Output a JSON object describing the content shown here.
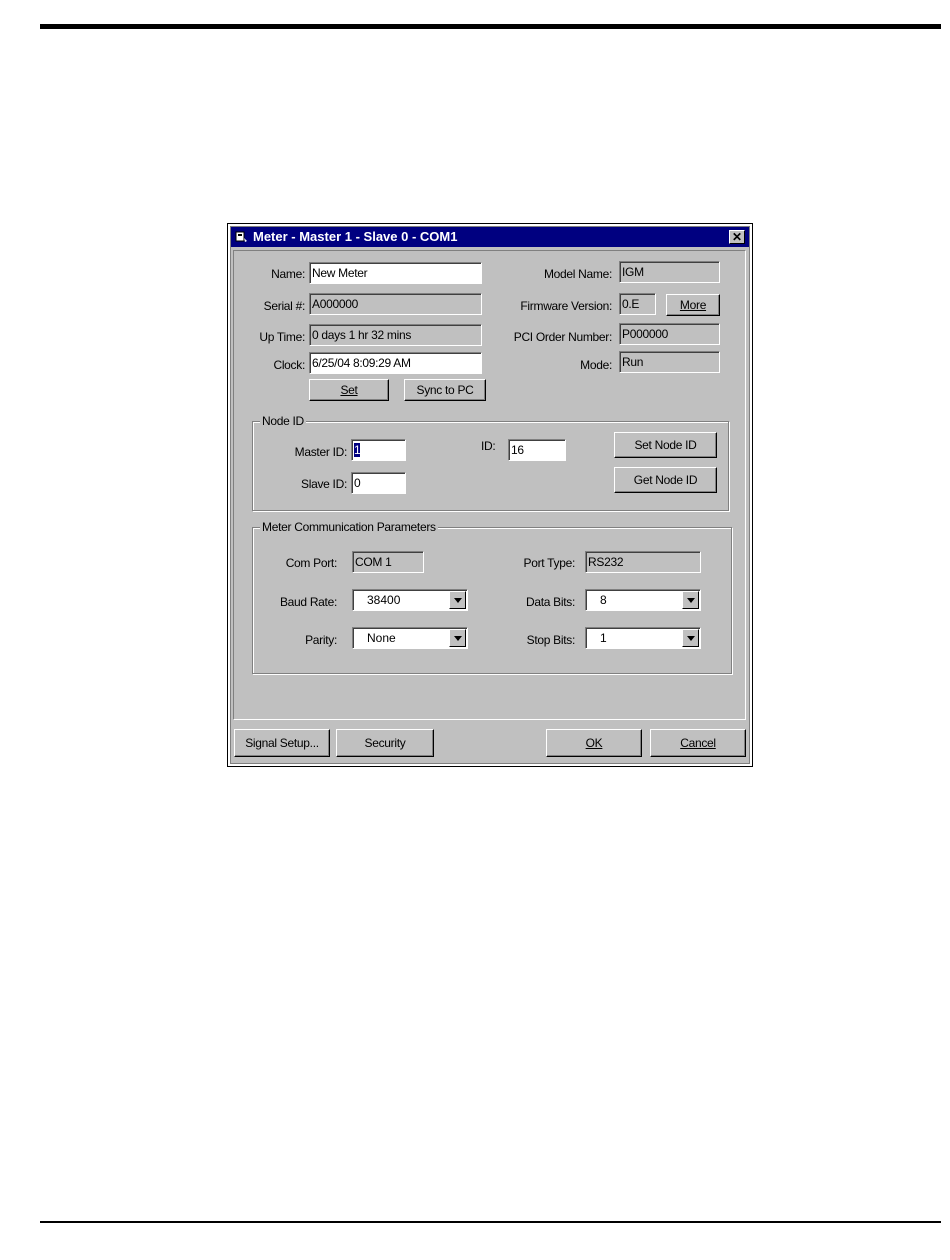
{
  "window": {
    "title": "Meter - Master 1 - Slave 0 - COM1",
    "close_glyph": "✕"
  },
  "general": {
    "name_label": "Name:",
    "name_value": "New Meter",
    "serial_label": "Serial #:",
    "serial_value": "A000000",
    "uptime_label": "Up Time:",
    "uptime_value": "0 days 1 hr 32 mins",
    "clock_label": "Clock:",
    "clock_value": "6/25/04 8:09:29 AM",
    "set_label": "Set",
    "sync_label": "Sync to PC",
    "model_label": "Model Name:",
    "model_value": "IGM",
    "firmware_label": "Firmware Version:",
    "firmware_value": "0.E",
    "more_label": "More",
    "pci_label": "PCI Order Number:",
    "pci_value": "P000000",
    "mode_label": "Mode:",
    "mode_value": "Run"
  },
  "node_id": {
    "group_title": "Node ID",
    "master_label": "Master ID:",
    "master_value": "1",
    "slave_label": "Slave ID:",
    "slave_value": "0",
    "id_label": "ID:",
    "id_value": "16",
    "set_node_label": "Set Node ID",
    "get_node_label": "Get Node ID"
  },
  "comm": {
    "group_title": "Meter Communication Parameters",
    "com_port_label": "Com Port:",
    "com_port_value": "COM 1",
    "port_type_label": "Port Type:",
    "port_type_value": "RS232",
    "baud_label": "Baud Rate:",
    "baud_value": "38400",
    "data_bits_label": "Data Bits:",
    "data_bits_value": "8",
    "parity_label": "Parity:",
    "parity_value": "None",
    "stop_bits_label": "Stop Bits:",
    "stop_bits_value": "1"
  },
  "footer": {
    "signal_setup_label": "Signal Setup...",
    "security_label": "Security",
    "ok_label": "OK",
    "cancel_label": "Cancel"
  }
}
